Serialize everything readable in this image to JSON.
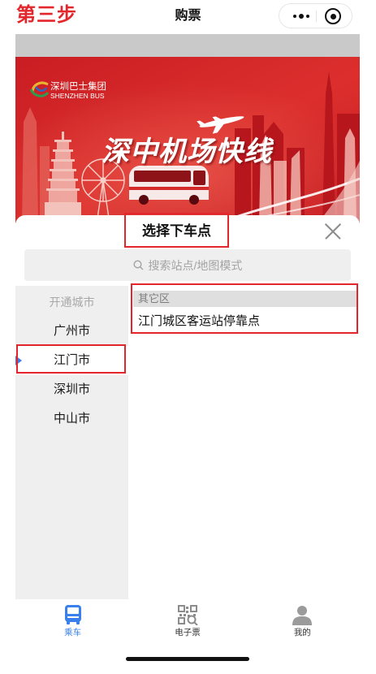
{
  "annotation": {
    "step_label": "第三步"
  },
  "header": {
    "title": "购票",
    "more_icon": "more-dots-icon",
    "capsule_close_icon": "target-circle-icon"
  },
  "banner": {
    "logo_cn": "深圳巴士集团",
    "logo_en": "SHENZHEN BUS",
    "headline": "深中机场快线"
  },
  "sheet": {
    "title": "选择下车点",
    "close_icon": "close-icon",
    "search": {
      "placeholder": "搜索站点/地图模式",
      "icon": "search-icon"
    }
  },
  "cities": {
    "heading": "开通城市",
    "items": [
      {
        "label": "广州市",
        "selected": false
      },
      {
        "label": "江门市",
        "selected": true
      },
      {
        "label": "深圳市",
        "selected": false
      },
      {
        "label": "中山市",
        "selected": false
      }
    ]
  },
  "stations": {
    "groups": [
      {
        "district": "其它区",
        "stops": [
          "江门城区客运站停靠点"
        ]
      }
    ]
  },
  "tabbar": {
    "items": [
      {
        "label": "乘车",
        "icon": "bus-icon",
        "active": true
      },
      {
        "label": "电子票",
        "icon": "qr-ticket-icon",
        "active": false
      },
      {
        "label": "我的",
        "icon": "person-icon",
        "active": false
      }
    ]
  },
  "colors": {
    "accent": "#3a80ea",
    "annotation_red": "#e3262b",
    "banner_red": "#d42a2a",
    "sidebar_bg": "#efefef"
  }
}
